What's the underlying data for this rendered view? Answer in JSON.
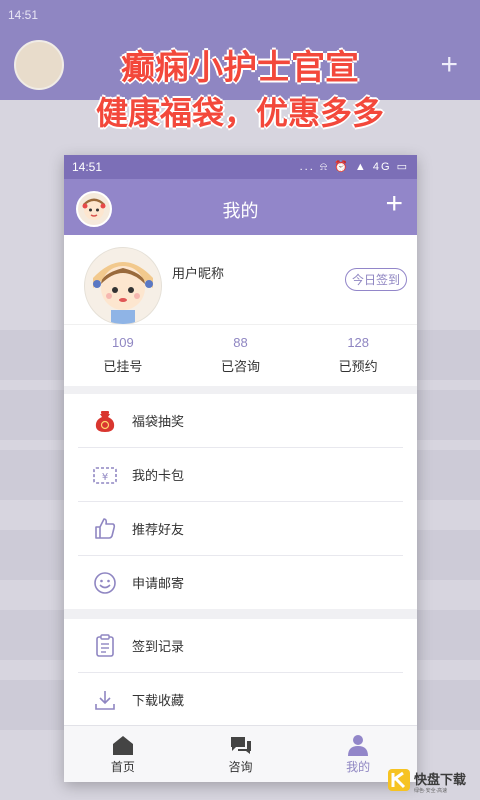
{
  "background": {
    "status_time": "14:51"
  },
  "promo": {
    "line1": "癫痫小护士官宣",
    "line2": "健康福袋，优惠多多"
  },
  "phone": {
    "status": {
      "time": "14:51",
      "icons": "... ⍾ ⏰ ▲ 4G ▭"
    },
    "appbar": {
      "title": "我的",
      "plus": "+"
    },
    "profile": {
      "nickname": "用户昵称",
      "signin_label": "今日签到"
    },
    "stats": [
      {
        "num": "109",
        "label": "已挂号"
      },
      {
        "num": "88",
        "label": "已咨询"
      },
      {
        "num": "128",
        "label": "已预约"
      }
    ],
    "menu_group1": [
      {
        "label": "福袋抽奖",
        "icon": "lucky-bag-icon"
      },
      {
        "label": "我的卡包",
        "icon": "card-wallet-icon"
      },
      {
        "label": "推荐好友",
        "icon": "thumb-up-icon"
      },
      {
        "label": "申请邮寄",
        "icon": "smiley-icon"
      }
    ],
    "menu_group2": [
      {
        "label": "签到记录",
        "icon": "clipboard-icon"
      },
      {
        "label": "下载收藏",
        "icon": "download-icon"
      }
    ],
    "tabs": [
      {
        "label": "首页",
        "icon": "home-icon",
        "active": false
      },
      {
        "label": "咨询",
        "icon": "chat-icon",
        "active": false
      },
      {
        "label": "我的",
        "icon": "user-icon",
        "active": true
      }
    ],
    "accent_color": "#9286c9"
  },
  "watermark": {
    "text": "快盘下载",
    "sub": "绿色·安全·高速"
  }
}
